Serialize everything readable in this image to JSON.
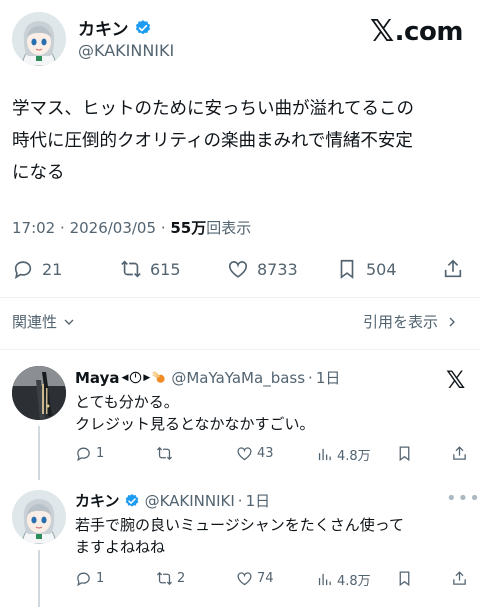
{
  "header": {
    "author_name": "カキン",
    "author_handle": "@KAKINNIKI",
    "brand_x": "𝕏",
    "brand_suffix": ".com"
  },
  "tweet": {
    "text_lines": [
      "学マス、ヒットのために安っちい曲が溢れてるこの",
      "時代に圧倒的クオリティの楽曲まみれで情緒不安定",
      "になる"
    ],
    "time": "17:02",
    "date": "2026/03/05",
    "views_count": "55万",
    "views_label": "回表示"
  },
  "actions": {
    "replies": "21",
    "retweets": "615",
    "likes": "8733",
    "bookmarks": "504"
  },
  "links": {
    "related": "関連性",
    "quote": "引用を表示"
  },
  "replies": [
    {
      "name": "Maya",
      "handle": "@MaYaYaMa_bass",
      "time": "1日",
      "text_lines": [
        "とても分かる。",
        "クレジット見るとなかなかすごい。"
      ],
      "reply_count": "1",
      "retweet_count": "",
      "like_count": "43",
      "view_count": "4.8万"
    },
    {
      "name": "カキン",
      "handle": "@KAKINNIKI",
      "time": "1日",
      "text_lines": [
        "若手で腕の良いミュージシャンをたくさん使って",
        "ますよねねね"
      ],
      "reply_count": "1",
      "retweet_count": "2",
      "like_count": "74",
      "view_count": "4.8万"
    }
  ],
  "colors": {
    "text": "#0f1419",
    "secondary": "#536471",
    "verified": "#1d9bf0",
    "divider": "#eff3f4"
  },
  "icons": [
    "verified-badge-icon",
    "reply-icon",
    "retweet-icon",
    "like-icon",
    "bookmark-icon",
    "share-icon",
    "chevron-down-icon",
    "chevron-right-icon",
    "x-logo-icon",
    "more-icon",
    "views-icon"
  ]
}
